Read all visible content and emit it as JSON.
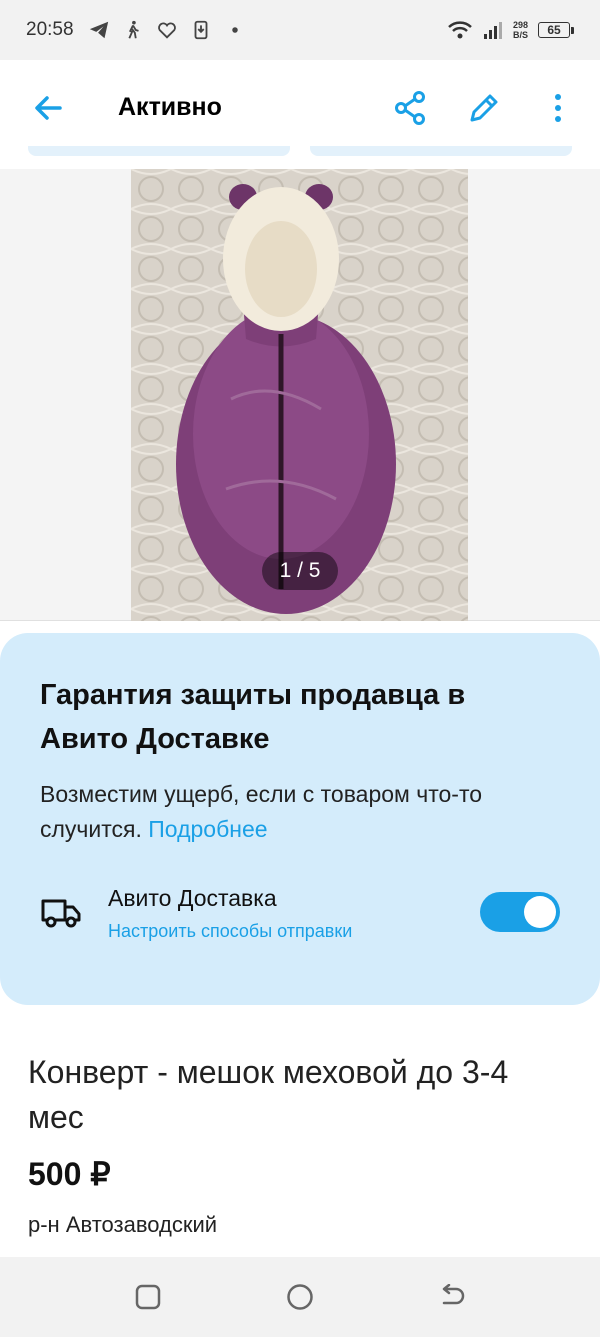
{
  "status_bar": {
    "time": "20:58",
    "net_speed_value": "298",
    "net_speed_unit": "B/S",
    "battery": "65"
  },
  "app_bar": {
    "title": "Активно"
  },
  "photo": {
    "counter": "1 / 5"
  },
  "guarantee": {
    "title": "Гарантия защиты продавца в Авито Доставке",
    "text": "Возместим ущерб, если с товаром что-то случится.",
    "more_link": "Подробнее",
    "delivery_name": "Авито Доставка",
    "delivery_setup": "Настроить способы отправки",
    "toggle_on": true
  },
  "listing": {
    "title": "Конверт - мешок меховой до 3-4 мес",
    "price": "500 ₽",
    "district": "р-н Автозаводский"
  },
  "colors": {
    "accent": "#1aa0e6",
    "card_bg": "#d4ecfb"
  }
}
